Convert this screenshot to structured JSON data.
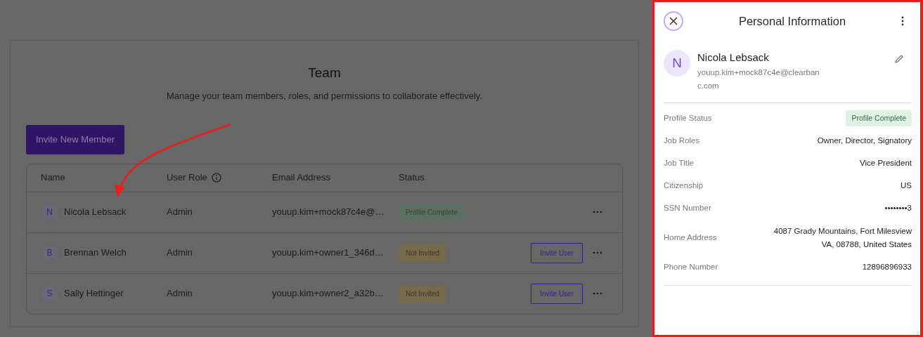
{
  "team": {
    "title": "Team",
    "subtitle": "Manage your team members, roles, and permissions to collaborate effectively.",
    "invite_button": "Invite New Member",
    "table": {
      "columns": [
        {
          "label": "Name",
          "info": false
        },
        {
          "label": "User Role",
          "info": true
        },
        {
          "label": "Email Address",
          "info": false
        },
        {
          "label": "Status",
          "info": false
        }
      ],
      "rows": [
        {
          "initial": "N",
          "name": "Nicola Lebsack",
          "role": "Admin",
          "email": "youup.kim+mock87c4e@…",
          "status": "Profile Complete",
          "kind": "complete",
          "action": null
        },
        {
          "initial": "B",
          "name": "Brennan Welch",
          "role": "Admin",
          "email": "youup.kim+owner1_346d…",
          "status": "Not Invited",
          "kind": "pending",
          "action": "Invite User"
        },
        {
          "initial": "S",
          "name": "Sally Hettinger",
          "role": "Admin",
          "email": "youup.kim+owner2_a32b…",
          "status": "Not Invited",
          "kind": "pending",
          "action": "Invite User"
        }
      ]
    }
  },
  "panel": {
    "title": "Personal Information",
    "initial": "N",
    "name": "Nicola Lebsack",
    "email": "youup.kim+mock87c4e@clearbanc.com",
    "fields": [
      {
        "label": "Profile Status",
        "value": "Profile Complete",
        "kind": "badge"
      },
      {
        "label": "Job Roles",
        "value": "Owner, Director, Signatory",
        "kind": "text"
      },
      {
        "label": "Job Title",
        "value": "Vice President",
        "kind": "text"
      },
      {
        "label": "Citizenship",
        "value": "US",
        "kind": "text"
      },
      {
        "label": "SSN Number",
        "value": "••••••••3",
        "kind": "text"
      },
      {
        "label": "Home Address",
        "value": "4087 Grady Mountains, Fort Milesview\nVA, 08788, United States",
        "kind": "text"
      },
      {
        "label": "Phone Number",
        "value": "12896896933",
        "kind": "text"
      }
    ]
  }
}
